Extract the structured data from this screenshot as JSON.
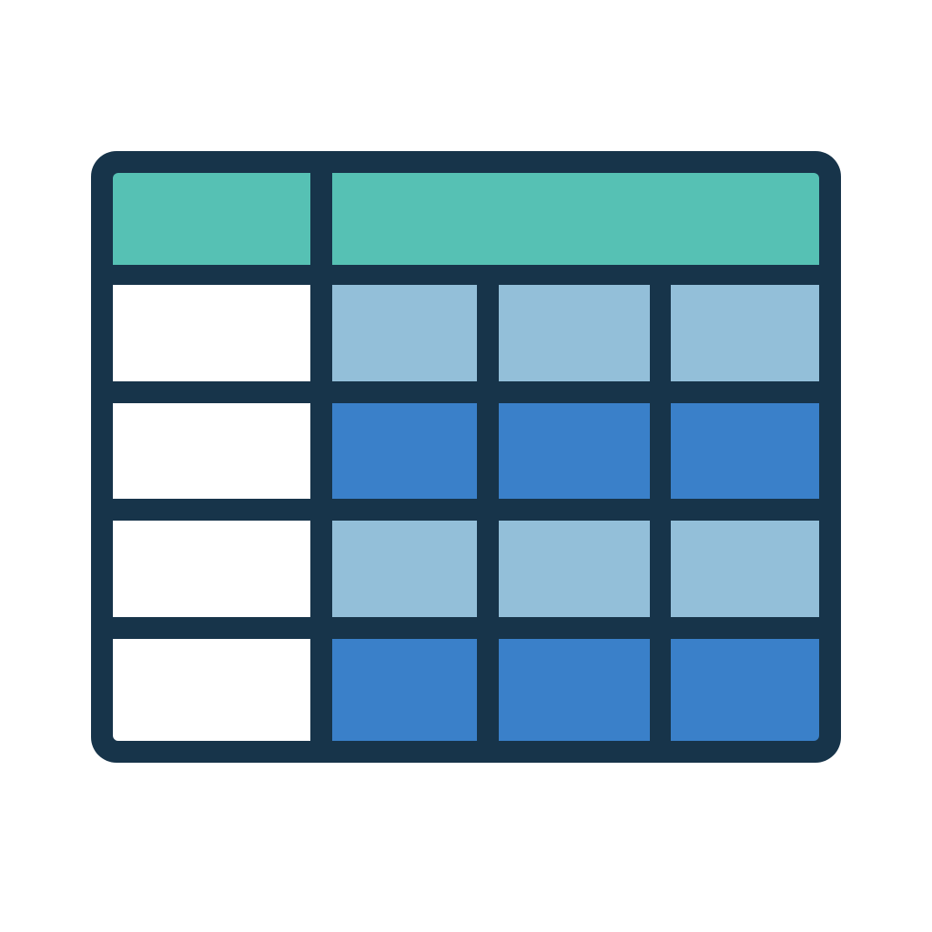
{
  "icon": {
    "semantic": "table-icon",
    "colors": {
      "frame": "#17344a",
      "header": "#56c1b4",
      "row_label": "#ffffff",
      "light_row": "#93bfd9",
      "dark_row": "#3a80c9",
      "background": "#ffffff"
    },
    "rows": [
      {
        "kind": "header"
      },
      {
        "kind": "light"
      },
      {
        "kind": "dark"
      },
      {
        "kind": "light"
      },
      {
        "kind": "dark"
      }
    ]
  }
}
